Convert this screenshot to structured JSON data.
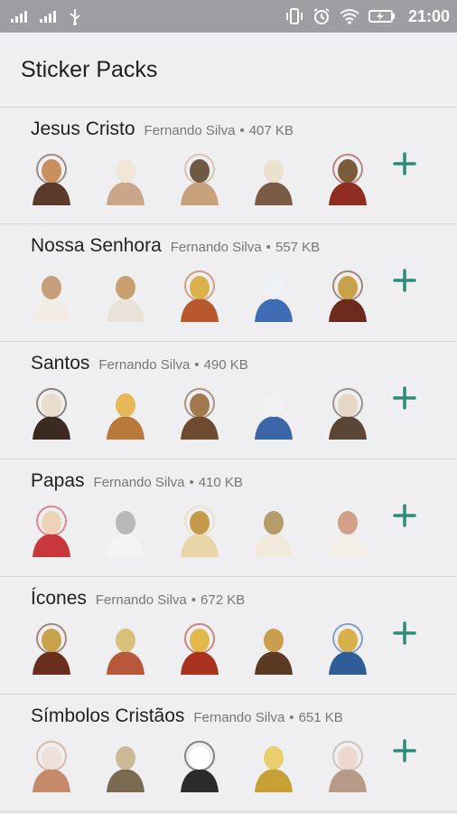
{
  "status_bar": {
    "time": "21:00",
    "icons": [
      "signal-icon",
      "signal-icon",
      "usb-icon",
      "vibrate-icon",
      "alarm-icon",
      "wifi-icon",
      "battery-charging-icon"
    ]
  },
  "header": {
    "title": "Sticker Packs"
  },
  "packs": [
    {
      "name": "Jesus Cristo",
      "author": "Fernando Silva",
      "size": "407 KB",
      "stickers": [
        "praying-jesus",
        "jesus-with-child",
        "angel",
        "ascending-jesus",
        "jesus-at-door"
      ],
      "colors": [
        [
          "#5a3b2a",
          "#c98f5e"
        ],
        [
          "#caa78a",
          "#f1e5d6"
        ],
        [
          "#c7a07c",
          "#6f5a44"
        ],
        [
          "#7a5b46",
          "#ece0cf"
        ],
        [
          "#8f2d20",
          "#7a5b3a"
        ]
      ]
    },
    {
      "name": "Nossa Senhora",
      "author": "Fernando Silva",
      "size": "557 KB",
      "stickers": [
        "virgin-mary",
        "our-lady-fatima",
        "our-lady-guadalupe",
        "mary-blue-mantle",
        "perpetual-help-icon"
      ],
      "colors": [
        [
          "#f2ece4",
          "#c59e7c"
        ],
        [
          "#e9e2d8",
          "#c8a070"
        ],
        [
          "#b8582e",
          "#d9b24d"
        ],
        [
          "#3f6db3",
          "#eef1f5"
        ],
        [
          "#6b2a1c",
          "#c7a24a"
        ]
      ]
    },
    {
      "name": "Santos",
      "author": "Fernando Silva",
      "size": "490 KB",
      "stickers": [
        "saint-therese",
        "child-saint",
        "saint-with-cross",
        "mother-teresa",
        "padre-pio"
      ],
      "colors": [
        [
          "#3a2a22",
          "#e8dccc"
        ],
        [
          "#b87a3a",
          "#e6b85a"
        ],
        [
          "#6d4a30",
          "#a0794f"
        ],
        [
          "#3a66a8",
          "#f2f2f2"
        ],
        [
          "#5a4636",
          "#e6d6c6"
        ]
      ]
    },
    {
      "name": "Papas",
      "author": "Fernando Silva",
      "size": "410 KB",
      "stickers": [
        "pope-portrait",
        "pope-hugging",
        "pope-seated",
        "pope-with-staff",
        "pope-waving"
      ],
      "colors": [
        [
          "#c8373b",
          "#eed2b8"
        ],
        [
          "#f4f4f4",
          "#b8b8b8"
        ],
        [
          "#e9d6a8",
          "#c49a4a"
        ],
        [
          "#f0e9dc",
          "#b69c6a"
        ],
        [
          "#f3eee8",
          "#d2a088"
        ]
      ]
    },
    {
      "name": "Ícones",
      "author": "Fernando Silva",
      "size": "672 KB",
      "stickers": [
        "icon-mother-child",
        "icon-saint-red",
        "icon-saint-gold",
        "icon-christ",
        "icon-round-christ"
      ],
      "colors": [
        [
          "#6b2e1e",
          "#c7a24a"
        ],
        [
          "#b8583a",
          "#d9c07a"
        ],
        [
          "#a8321e",
          "#e2b84a"
        ],
        [
          "#5a3a22",
          "#c99f4e"
        ],
        [
          "#2f5d99",
          "#d8b04a"
        ]
      ]
    },
    {
      "name": "Símbolos Cristãos",
      "author": "Fernando Silva",
      "size": "651 KB",
      "stickers": [
        "chi-rho-medallion",
        "crown-of-thorns",
        "jesus-fish",
        "orthodox-cross",
        "helping-hand"
      ],
      "colors": [
        [
          "#c48a6a",
          "#eee0d8"
        ],
        [
          "#7a6a52",
          "#cbb998"
        ],
        [
          "#2b2b2b",
          "#ffffff"
        ],
        [
          "#c7a036",
          "#e8cf6e"
        ],
        [
          "#b89a88",
          "#ecd8cc"
        ]
      ]
    }
  ],
  "colors": {
    "accent": "#2e8b7a",
    "statusbar": "#9e9ea2",
    "background": "#efeff1"
  }
}
